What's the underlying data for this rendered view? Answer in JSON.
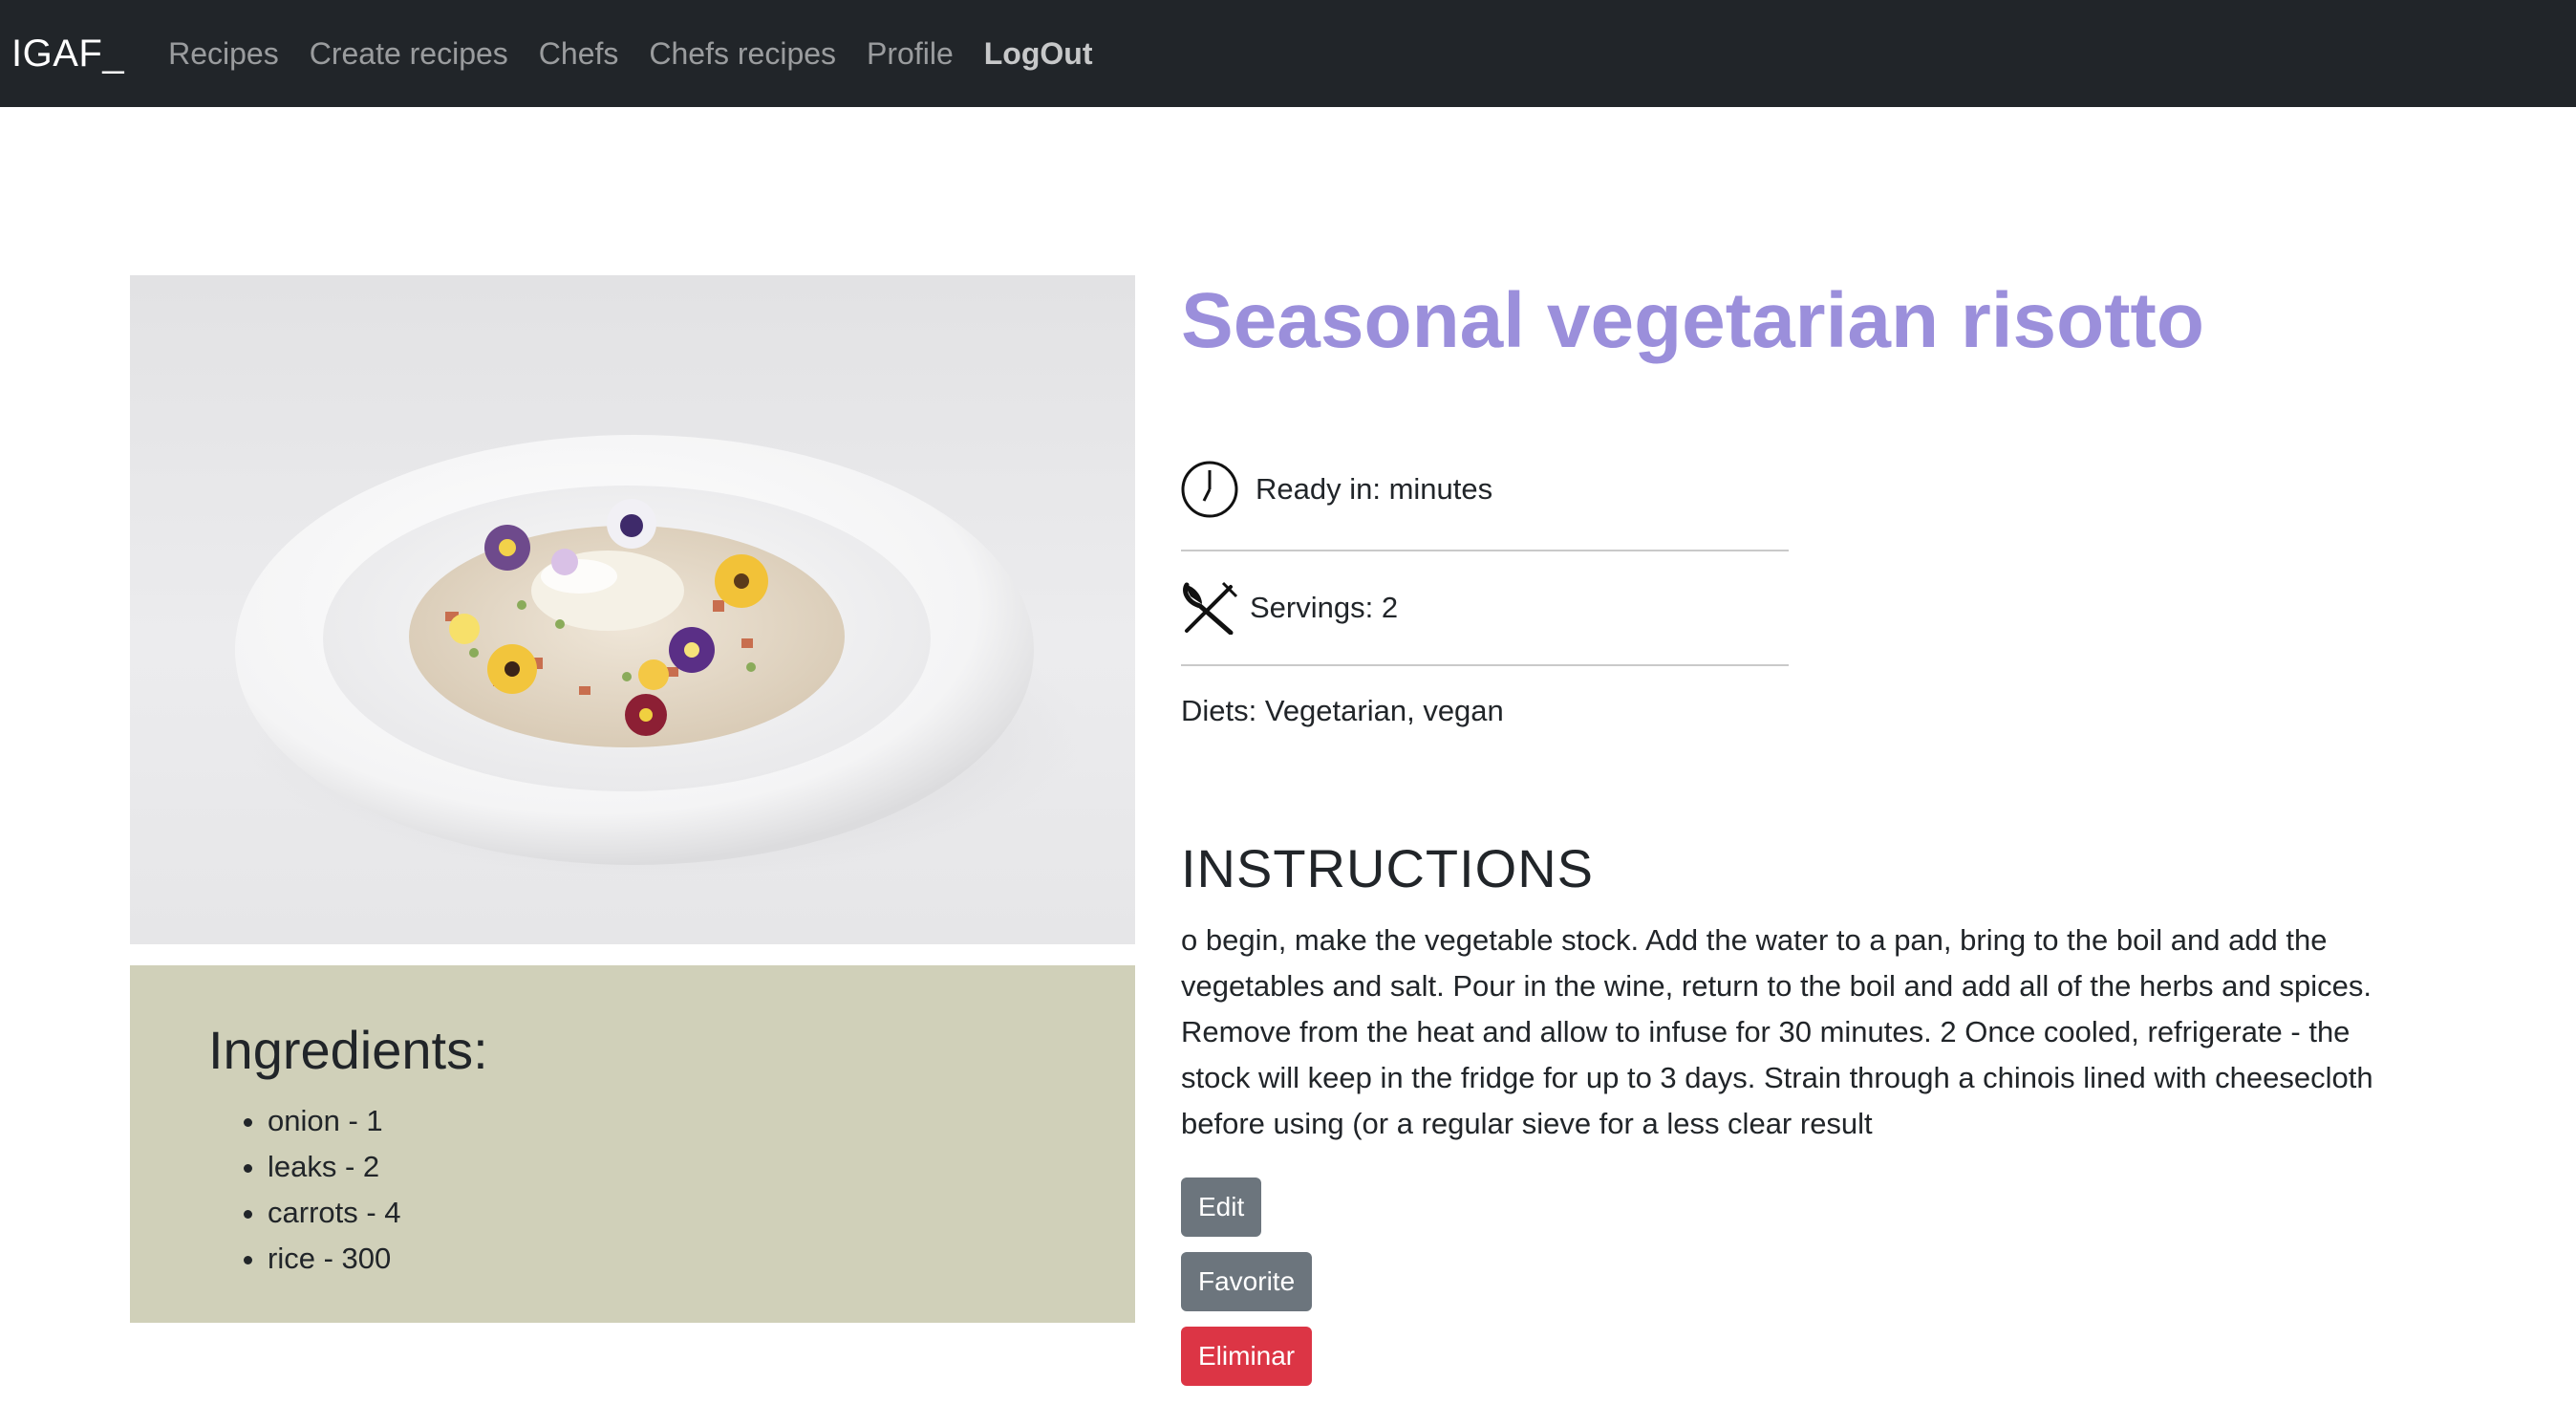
{
  "nav": {
    "brand": "IGAF_",
    "links": [
      {
        "label": "Recipes"
      },
      {
        "label": "Create recipes"
      },
      {
        "label": "Chefs"
      },
      {
        "label": "Chefs recipes"
      },
      {
        "label": "Profile"
      },
      {
        "label": "LogOut"
      }
    ]
  },
  "recipe": {
    "title": "Seasonal vegetarian risotto",
    "ready_in": "Ready in: minutes",
    "servings": "Servings: 2",
    "diets": "Diets: Vegetarian, vegan",
    "instructions_title": "INSTRUCTIONS",
    "instructions": "o begin, make the vegetable stock. Add the water to a pan, bring to the boil and add the vegetables and salt. Pour in the wine, return to the boil and add all of the herbs and spices. Remove from the heat and allow to infuse for 30 minutes. 2 Once cooled, refrigerate - the stock will keep in the fridge for up to 3 days. Strain through a chinois lined with cheesecloth before using (or a regular sieve for a less clear result"
  },
  "ingredients": {
    "title": "Ingredients:",
    "items": [
      "onion - 1",
      "leaks - 2",
      "carrots - 4",
      "rice - 300"
    ]
  },
  "actions": {
    "edit": "Edit",
    "favorite": "Favorite",
    "delete": "Eliminar"
  },
  "icons": {
    "clock": "clock-icon",
    "servings": "fork-knife-icon"
  },
  "colors": {
    "navbar": "#212529",
    "title": "#9b8fdb",
    "ingredients_bg": "#d0d0b9",
    "btn_secondary": "#6c757d",
    "btn_danger": "#dc3545"
  }
}
